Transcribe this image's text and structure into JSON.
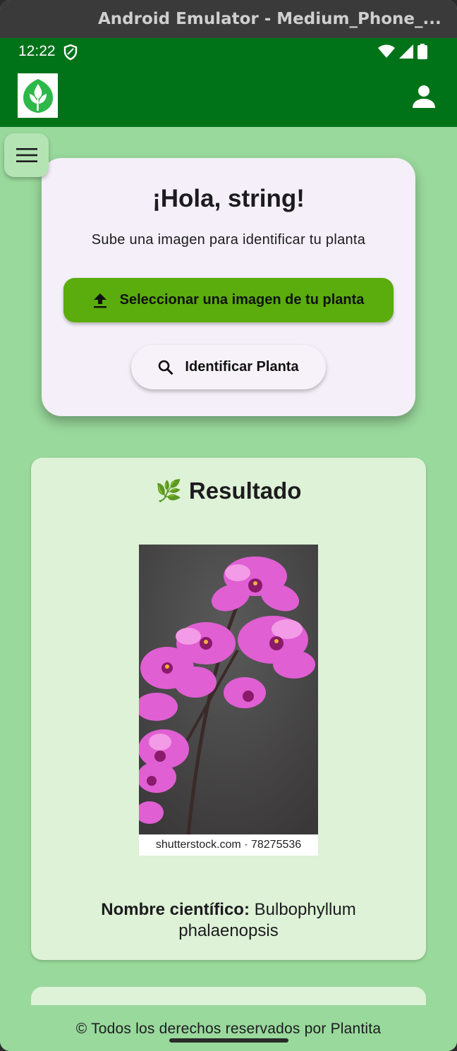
{
  "window": {
    "title": "Android Emulator - Medium_Phone_..."
  },
  "status_bar": {
    "time": "12:22"
  },
  "app_bar": {
    "logo_icon": "plant-logo-icon",
    "profile_icon": "person-icon"
  },
  "menu": {
    "icon": "hamburger-menu-icon"
  },
  "upload_card": {
    "greeting": "¡Hola, string!",
    "subtitle": "Sube una imagen para identificar tu planta",
    "select_button_label": "Seleccionar una imagen de tu planta",
    "identify_button_label": "Identificar Planta"
  },
  "result_card": {
    "emoji": "🌿",
    "title": "Resultado",
    "image_watermark": "shutterstock.com · 78275536",
    "scientific_name_label": "Nombre científico:",
    "scientific_name_value": "Bulbophyllum phalaenopsis"
  },
  "footer": {
    "text": "© Todos los derechos reservados por Plantita"
  },
  "colors": {
    "primary": "#007319",
    "background": "#99d99c",
    "button_green": "#5aad0c",
    "card_light": "#f4eff8",
    "result_card": "#ddf2d6"
  }
}
